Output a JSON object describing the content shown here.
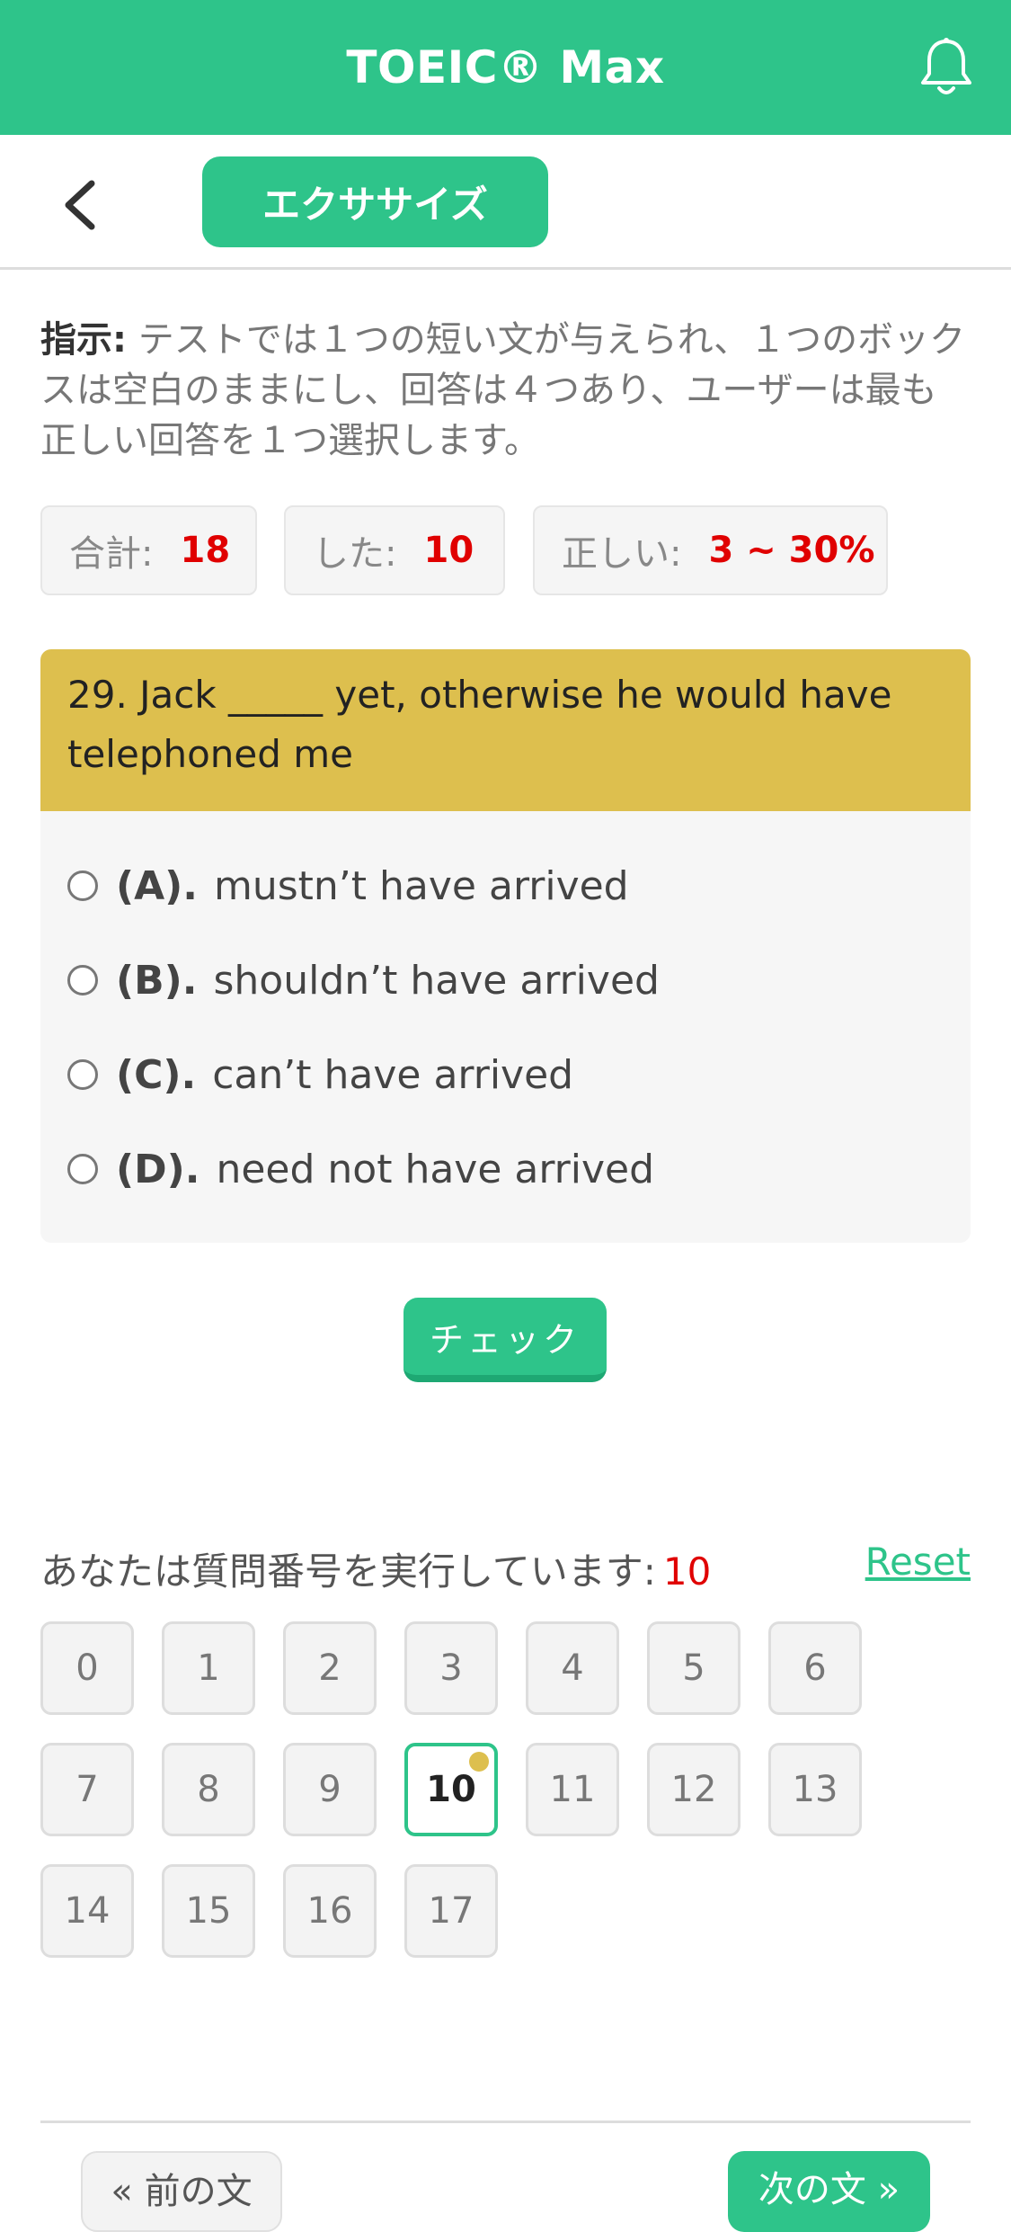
{
  "header": {
    "title": "TOEIC® Max",
    "bell_icon": "bell-icon"
  },
  "subbar": {
    "back_icon": "chevron-left-icon",
    "tab_label": "エクササイズ"
  },
  "instructions": {
    "label": "指示:",
    "text": " テストでは１つの短い文が与えられ、１つのボックスは空白のままにし、回答は４つあり、ユーザーは最も正しい回答を１つ選択します。"
  },
  "stats": {
    "total_label": "合計:",
    "total_value": "18",
    "done_label": "した:",
    "done_value": "10",
    "correct_label": "正しい:",
    "correct_value": "3 ~ 30%"
  },
  "question": {
    "text": "29. Jack _____ yet, otherwise he would have telephoned me",
    "options": [
      {
        "label": "(A).",
        "text": "mustn’t have arrived"
      },
      {
        "label": "(B).",
        "text": "shouldn’t have arrived"
      },
      {
        "label": "(C).",
        "text": "can’t have arrived"
      },
      {
        "label": "(D).",
        "text": "need not have arrived"
      }
    ]
  },
  "check_label": "チェック",
  "progress": {
    "label": "あなたは質問番号を実行しています:",
    "current": "10",
    "reset_label": "Reset",
    "numbers": [
      "0",
      "1",
      "2",
      "3",
      "4",
      "5",
      "6",
      "7",
      "8",
      "9",
      "10",
      "11",
      "12",
      "13",
      "14",
      "15",
      "16",
      "17"
    ]
  },
  "nav": {
    "prev_label": "« 前の文",
    "next_label": "次の文 »"
  },
  "colors": {
    "accent": "#2ec48a",
    "question_header": "#ddbf4e",
    "highlight": "#e00000"
  }
}
